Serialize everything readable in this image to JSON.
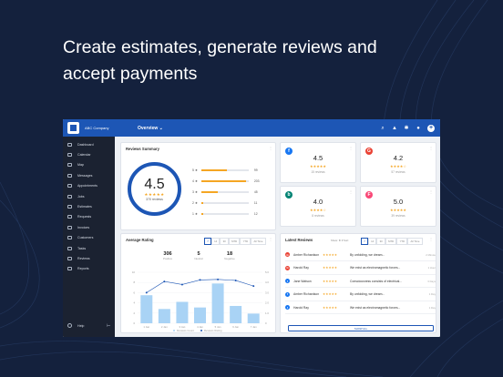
{
  "headline": {
    "line1": "Create estimates, generate reviews and",
    "line2": "accept payments"
  },
  "topbar": {
    "company": "ABC Company",
    "company_caret": "⌄",
    "page": "Overview ⌄"
  },
  "sidebar": {
    "items": [
      {
        "label": "Dashboard"
      },
      {
        "label": "Calendar"
      },
      {
        "label": "Map"
      },
      {
        "label": "Messages"
      },
      {
        "label": "Appointments"
      },
      {
        "label": "Jobs"
      },
      {
        "label": "Estimates"
      },
      {
        "label": "Requests"
      },
      {
        "label": "Invoices"
      },
      {
        "label": "Customers"
      },
      {
        "label": "Tasks"
      },
      {
        "label": "Reviews"
      },
      {
        "label": "Reports"
      }
    ],
    "help": "Help"
  },
  "summary": {
    "title": "Reviews Summary",
    "rating": "4.5",
    "stars": "★★★★★",
    "count_label": "370 reviews",
    "bars": [
      {
        "label": "5 ★",
        "value": 0.55,
        "count": "99"
      },
      {
        "label": "4 ★",
        "value": 0.95,
        "count": "203"
      },
      {
        "label": "3 ★",
        "value": 0.35,
        "count": "45"
      },
      {
        "label": "2 ★",
        "value": 0.05,
        "count": "11"
      },
      {
        "label": "1 ★",
        "value": 0.04,
        "count": "12"
      }
    ]
  },
  "sources": [
    {
      "name": "facebook-icon",
      "glyph": "f",
      "color": "#1877f2",
      "rating": "4.5",
      "stars": "★★★★★",
      "count": "15 reviews"
    },
    {
      "name": "google-icon",
      "glyph": "G",
      "color": "#ea4335",
      "rating": "4.2",
      "stars": "★★★★☆",
      "count": "57 reviews"
    },
    {
      "name": "bing-icon",
      "glyph": "b",
      "color": "#008373",
      "rating": "4.0",
      "stars": "★★★★☆",
      "count": "8 reviews"
    },
    {
      "name": "foursquare-icon",
      "glyph": "F",
      "color": "#f94877",
      "rating": "5.0",
      "stars": "★★★★★",
      "count": "39 reviews"
    }
  ],
  "avg": {
    "title": "Average Rating",
    "ranges": [
      "7",
      "14",
      "30",
      "MTD",
      "YTD",
      "All Time"
    ],
    "stats": [
      {
        "n": "306",
        "l": "Positive"
      },
      {
        "n": "5",
        "l": "Neutral"
      },
      {
        "n": "18",
        "l": "Negative"
      }
    ],
    "legend_count": "Reviews Count",
    "legend_rating": "Reviews Rating"
  },
  "chart_data": {
    "type": "bar",
    "categories": [
      "1 Jan",
      "2 Jan",
      "3 Jan",
      "4 Jan",
      "5 Jan",
      "6 Jan",
      "7 Jan"
    ],
    "series": [
      {
        "name": "Reviews Count",
        "values": [
          5.5,
          2.8,
          4.2,
          3.1,
          7.8,
          3.4,
          1.9
        ]
      },
      {
        "name": "Reviews Rating",
        "values": [
          6.0,
          8.2,
          7.6,
          8.5,
          8.6,
          8.4,
          7.3
        ]
      }
    ],
    "yticks_left": [
      "10",
      "8",
      "6",
      "4",
      "2",
      "0"
    ],
    "yticks_right": [
      "5.0",
      "4.0",
      "3.0",
      "2.0",
      "1.0",
      "0"
    ],
    "ylim": [
      0,
      10
    ]
  },
  "latest": {
    "title": "Latest Reviews",
    "filter": "Show: ★ ▾  Sort:",
    "ranges": [
      "7",
      "14",
      "30",
      "MTD",
      "YTD",
      "All Time"
    ],
    "rows": [
      {
        "platform": "google",
        "glyph": "G",
        "color": "#ea4335",
        "name": "Amber Richardson",
        "stars": "★★★★★",
        "text": "By unfolding, we dream...",
        "date": "2 Minute"
      },
      {
        "platform": "google",
        "glyph": "G",
        "color": "#ea4335",
        "name": "Harold Ray",
        "stars": "★★★★★",
        "text": "We exist as electromagnetic forces...",
        "date": "1 Hour"
      },
      {
        "platform": "facebook",
        "glyph": "f",
        "color": "#1877f2",
        "name": "Jane Watson",
        "stars": "★★★★★",
        "text": "Consciousness consists of electrical...",
        "date": "3 Days"
      },
      {
        "platform": "facebook",
        "glyph": "f",
        "color": "#1877f2",
        "name": "Amber Richardson",
        "stars": "★★★★★",
        "text": "By unfolding, we dream...",
        "date": "1 Day"
      },
      {
        "platform": "facebook",
        "glyph": "f",
        "color": "#1877f2",
        "name": "Harold Ray",
        "stars": "★★★★★",
        "text": "We exist as electromagnetic forces...",
        "date": "1 Day"
      }
    ],
    "show_all": "SHOW ALL"
  }
}
